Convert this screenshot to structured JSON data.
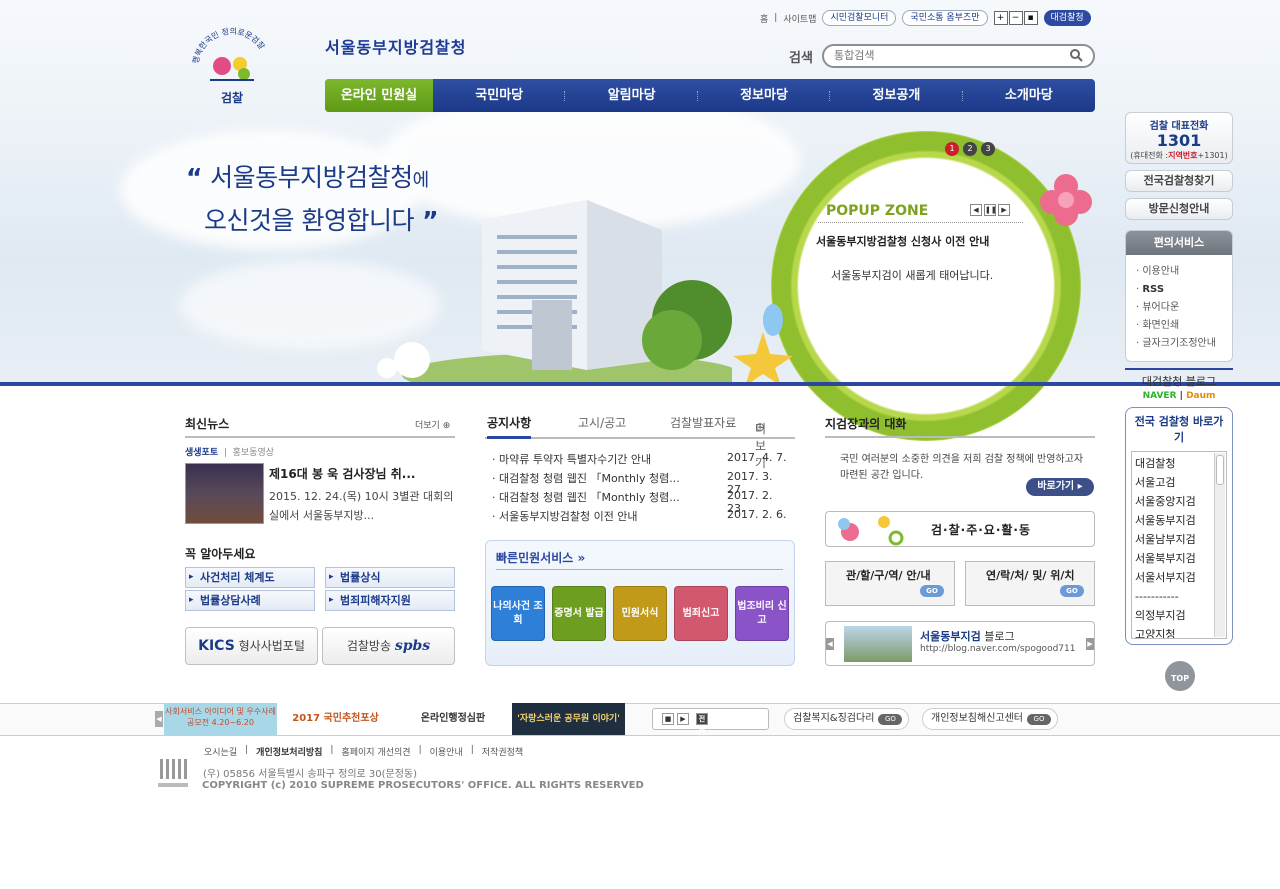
{
  "header": {
    "logo_text": "검찰",
    "logo_arc": "행복한국민 정의로운검찰",
    "agency_name": "서울동부지방검찰청",
    "util": {
      "home": "홈",
      "sitemap": "사이트맵",
      "monitor": "시민검찰모니터",
      "ombudsman": "국민소통 옴부즈만",
      "zoom_in": "+",
      "zoom_out": "−",
      "zoom_reset": "▪",
      "supreme": "대검찰청"
    },
    "search": {
      "label": "검색",
      "placeholder": "통합검색"
    },
    "gnb": [
      "온라인 민원실",
      "국민마당",
      "알림마당",
      "정보마당",
      "정보공개",
      "소개마당"
    ]
  },
  "visual": {
    "welcome_line1": "서울동부지방검찰청",
    "welcome_suffix1": "에",
    "welcome_line2": "오신것을 환영합니다",
    "popup": {
      "title": "POPUP ZONE",
      "pages": [
        "1",
        "2",
        "3"
      ],
      "headline": "서울동부지방검찰청 신청사 이전 안내",
      "body": "서울동부지검이 새롭게 태어납니다."
    }
  },
  "quick": {
    "tel_title": "검찰 대표전화",
    "tel_number": "1301",
    "tel_note_prefix": "(휴대전화 :",
    "tel_note_red": "지역번호",
    "tel_note_suffix": "+1301)",
    "find_office": "전국검찰청찾기",
    "visit": "방문신청안내",
    "conv_title": "편의서비스",
    "conv_items": [
      "이용안내",
      "RSS",
      "뷰어다운",
      "화면인쇄",
      "글자크기조정안내"
    ],
    "blog_label": "대검찰청 블로그",
    "portal_naver": "NAVER",
    "portal_daum": "Daum",
    "dir_title": "전국 검찰청 바로가기",
    "dir_items": [
      "대검찰청",
      "서울고검",
      "서울중앙지검",
      "서울동부지검",
      "서울남부지검",
      "서울북부지검",
      "서울서부지검",
      "-----------",
      "의정부지검",
      "고양지청"
    ],
    "top": "TOP"
  },
  "news": {
    "title": "최신뉴스",
    "more": "더보기",
    "tab_active": "생생포토",
    "tab_other": "홍보동영상",
    "headline": "제16대 봉 욱 검사장님 취...",
    "body": "2015. 12. 24.(목) 10시 3별관 대회의실에서 서울동부지방..."
  },
  "must_know": {
    "title": "꼭 알아두세요",
    "links": [
      "사건처리 체계도",
      "법률상식",
      "법률상담사례",
      "범죄피해자지원"
    ],
    "kics_label": "형사사법포털",
    "kics_brand": "KICS",
    "spbs_label": "검찰방송",
    "spbs_brand": "spbs"
  },
  "notice": {
    "tabs": [
      "공지사항",
      "고시/공고",
      "검찰발표자료"
    ],
    "more": "더보기",
    "items": [
      {
        "title": "마약류 투약자 특별자수기간 안내",
        "date": "2017. 4. 7."
      },
      {
        "title": "대검찰청 청렴 웹진 「Monthly 청렴...",
        "date": "2017. 3. 27."
      },
      {
        "title": "대검찰청 청렴 웹진 「Monthly 청렴...",
        "date": "2017. 2. 23."
      },
      {
        "title": "서울동부지방검찰청 이전 안내",
        "date": "2017. 2. 6."
      }
    ]
  },
  "quick_service": {
    "title": "빠른민원서비스",
    "buttons": [
      {
        "label": "나의사건 조회",
        "color": "#2e7fd8"
      },
      {
        "label": "증명서 발급",
        "color": "#6d9e1f"
      },
      {
        "label": "민원서식",
        "color": "#c29a19"
      },
      {
        "label": "범죄신고",
        "color": "#d2586f"
      },
      {
        "label": "법조비리 신고",
        "color": "#8a53c8"
      }
    ]
  },
  "minister": {
    "title": "지검장과의 대화",
    "body": "국민 여러분의 소중한 의견을 저희 검찰 정책에 반영하고자 마련된 공간 입니다.",
    "go": "바로가기",
    "activity": "검·찰·주·요·활·동",
    "jurisdiction": "관/할/구/역/ 안/내",
    "contact": "연/락/처/ 및/ 위/치",
    "go_badge": "GO",
    "blog_title_bold": "서울동부지검",
    "blog_title_rest": " 블로그",
    "blog_url": "http://blog.naver.com/spogood711"
  },
  "footer": {
    "banner1": "사회서비스 아이디어 및 우수사례 공모전 4.20~6.20",
    "banner2": "2017 국민추천포상",
    "banner3": "온라인행정심판",
    "banner4": "'자랑스러운 공무원 이야기'",
    "view_all": "전체보기",
    "welfare": "검찰복지&징검다리",
    "privacy_center": "개인정보침해신고센터",
    "go_badge": "GO",
    "links": [
      "오시는길",
      "개인정보처리방침",
      "홈페이지 개선의견",
      "이용안내",
      "저작권정책"
    ],
    "address": "(우) 05856 서울특별시 송파구 정의로 30(문정동)",
    "copyright": "COPYRIGHT (c) 2010 SUPREME PROSECUTORS' OFFICE. ALL RIGHTS RESERVED"
  },
  "colors": {
    "navy": "#1b3a88",
    "green": "#7db72d",
    "blue_line": "#2b47a0"
  }
}
